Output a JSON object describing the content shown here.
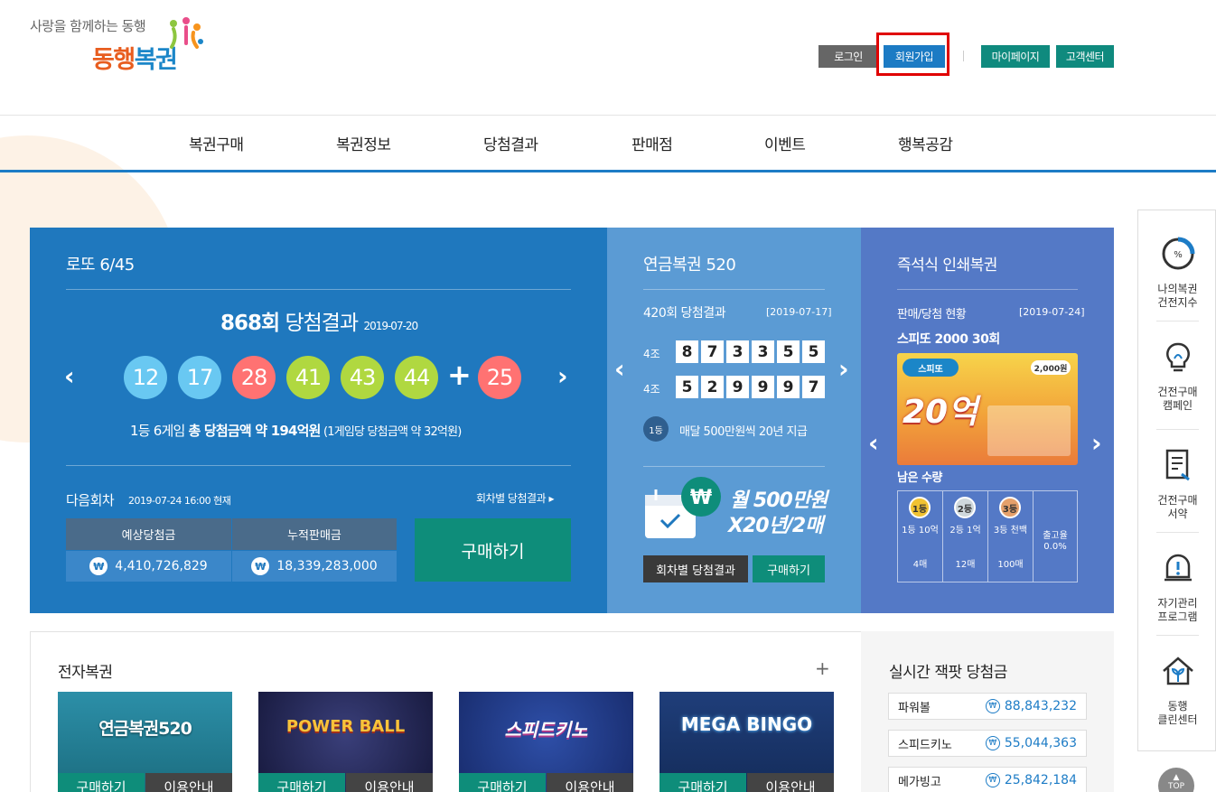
{
  "header": {
    "tagline": "사랑을 함께하는 동행",
    "brand_part1": "동행",
    "brand_part2": "복권",
    "buttons": {
      "login": "로그인",
      "join": "회원가입",
      "mypage": "마이페이지",
      "support": "고객센터"
    },
    "colors": {
      "login_bg": "#666666",
      "join_bg": "#1c7bc4",
      "mypage_bg": "#0f8a7e",
      "highlight": "#e00000"
    }
  },
  "nav": [
    "복권구매",
    "복권정보",
    "당첨결과",
    "판매점",
    "이벤트",
    "행복공감"
  ],
  "lotto": {
    "title": "로또 6/45",
    "round": "868회",
    "result_label": "당첨결과",
    "date": "2019-07-20",
    "numbers": [
      "12",
      "17",
      "28",
      "41",
      "43",
      "44"
    ],
    "bonus": "25",
    "plus": "+",
    "ball_colors": [
      "#69c8f2",
      "#69c8f2",
      "#ff7272",
      "#b0d840",
      "#b0d840",
      "#b0d840"
    ],
    "bonus_color": "#ff7272",
    "summary_prefix": "1등 6게임 ",
    "summary_bold": "총 당첨금액 약 194억원",
    "summary_suffix": " (1게임당 당첨금액 약 32억원)",
    "next_label": "다음회차",
    "next_time": "2019-07-24 16:00 현재",
    "history_link": "회차별 당첨결과",
    "table": {
      "col1_head": "예상당첨금",
      "col2_head": "누적판매금",
      "col1_value": "4,410,726,829",
      "col2_value": "18,339,283,000"
    },
    "won_symbol": "₩",
    "buy": "구매하기",
    "prev_arrow": "‹",
    "next_arrow": "›"
  },
  "pension": {
    "title": "연금복권 520",
    "round_label": "420회 당첨결과",
    "date": "[2019-07-17]",
    "row1_group": "4조",
    "row1_digits": [
      "8",
      "7",
      "3",
      "3",
      "5",
      "5"
    ],
    "row2_group": "4조",
    "row2_digits": [
      "5",
      "2",
      "9",
      "9",
      "9",
      "7"
    ],
    "prize_badge": "1등",
    "prize_text": "매달 500만원씩 20년 지급",
    "promo_line1": "월 500만원",
    "promo_line2": "X20년/2매",
    "history_btn": "회차별 당첨결과",
    "buy_btn": "구매하기"
  },
  "instant": {
    "title": "즉석식 인쇄복권",
    "status_label": "판매/당첨 현황",
    "date": "[2019-07-24]",
    "product": "스피또 2000 30회",
    "ticket_brand": "스피또",
    "ticket_amount": "20억",
    "ticket_prize": "2,000원",
    "remaining_label": "남은 수량",
    "tiers": [
      {
        "medal": "1등",
        "label": "1등 10억",
        "count": "4매"
      },
      {
        "medal": "2등",
        "label": "2등 1억",
        "count": "12매"
      },
      {
        "medal": "3등",
        "label": "3등 천백",
        "count": "100매"
      }
    ],
    "ratio_label": "출고율",
    "ratio_value": "0.0%"
  },
  "electronic": {
    "title": "전자복권",
    "more": "+",
    "games": [
      {
        "name": "연금복권520",
        "buy": "구매하기",
        "info": "이용안내"
      },
      {
        "name": "POWER BALL",
        "buy": "구매하기",
        "info": "이용안내"
      },
      {
        "name": "스피드키노",
        "buy": "구매하기",
        "info": "이용안내"
      },
      {
        "name": "MEGA BINGO",
        "buy": "구매하기",
        "info": "이용안내"
      }
    ]
  },
  "jackpot": {
    "title": "실시간 잭팟 당첨금",
    "rows": [
      {
        "name": "파워볼",
        "value": "88,843,232"
      },
      {
        "name": "스피드키노",
        "value": "55,044,363"
      },
      {
        "name": "메가빙고",
        "value": "25,842,184"
      }
    ]
  },
  "quick": [
    {
      "line1": "나의복권",
      "line2": "건전지수"
    },
    {
      "line1": "건전구매",
      "line2": "캠페인"
    },
    {
      "line1": "건전구매",
      "line2": "서약"
    },
    {
      "line1": "자기관리",
      "line2": "프로그램"
    },
    {
      "line1": "동행",
      "line2": "클린센터"
    }
  ],
  "top_button": "TOP"
}
